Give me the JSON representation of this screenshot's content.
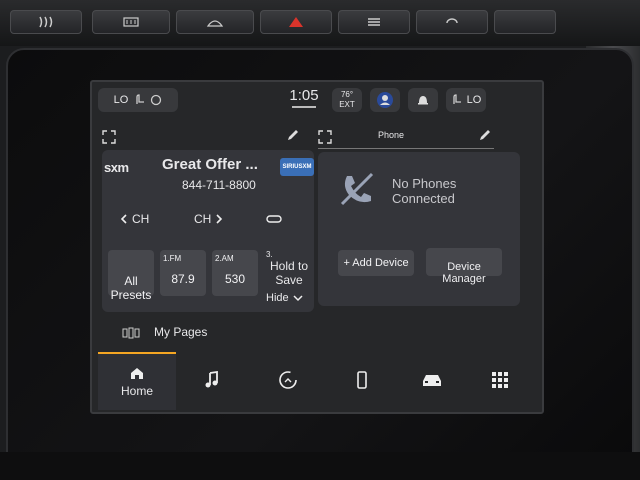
{
  "status_bar": {
    "left_climate_label": "LO",
    "time": "1:05",
    "ext_temp": "76°",
    "ext_label": "EXT",
    "right_climate_label": "LO"
  },
  "radio_card": {
    "brand": "sxm",
    "station_title": "Great Offer ...",
    "phone_number": "844-711-8800",
    "provider_badge": "SIRIUSXM",
    "ch_prev_label": "CH",
    "ch_next_label": "CH",
    "presets": [
      {
        "num": "",
        "label": "All\nPresets"
      },
      {
        "num": "1.FM",
        "label": "87.9"
      },
      {
        "num": "2.AM",
        "label": "530"
      },
      {
        "num": "3.",
        "label": "Hold to\nSave"
      }
    ],
    "hide_label": "Hide"
  },
  "phone_card": {
    "title": "Phone",
    "status_line1": "No Phones",
    "status_line2": "Connected",
    "add_device_label": "+ Add Device",
    "device_manager_label": "Device\nManager"
  },
  "my_pages_label": "My Pages",
  "nav": {
    "home_label": "Home",
    "items": [
      "media-icon",
      "comfort-icon",
      "phone-icon",
      "vehicle-icon",
      "apps-icon"
    ]
  },
  "colors": {
    "accent": "#f5a623",
    "screen_bg": "#262729",
    "card_bg": "#34353a",
    "tile_bg": "#46474c",
    "hazard": "#d9342b"
  }
}
